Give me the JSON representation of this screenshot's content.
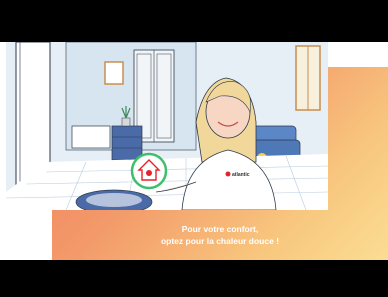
{
  "video": {
    "caption": {
      "line1": "Pour votre confort,",
      "line2": "optez pour la chaleur douce !"
    },
    "brand": {
      "name": "atlantic",
      "logo_icon": "atlantic-logo-icon"
    },
    "badge_icon": "home-heat-icon",
    "colors": {
      "gradient_start": "#f07d5e",
      "gradient_end": "#fbdd93",
      "scene_blue": "#cfe0ee",
      "badge_ring": "#3fbf6c",
      "sofa": "#5b87c6"
    }
  }
}
